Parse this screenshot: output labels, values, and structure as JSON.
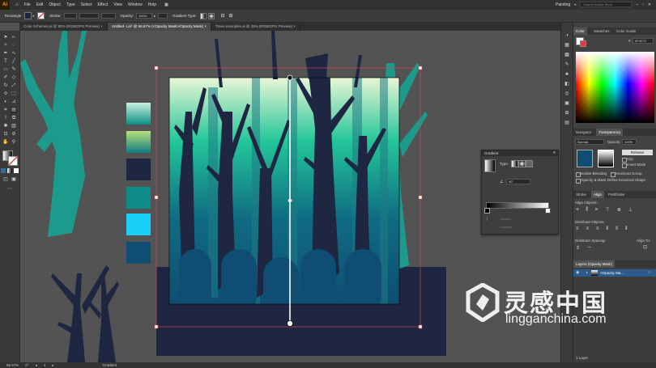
{
  "app": {
    "logo": "Ai",
    "home_icon": "home-icon"
  },
  "menu": [
    "File",
    "Edit",
    "Object",
    "Type",
    "Select",
    "Effect",
    "View",
    "Window",
    "Help"
  ],
  "workspace": "Painting",
  "search": {
    "placeholder": "Search Adobe Stock"
  },
  "controlbar": {
    "selection": "Rectangle",
    "stroke_label": "Stroke:",
    "opacity_label": "Opacity:",
    "opacity_value": "100%",
    "gradient_type_label": "Gradient Type:"
  },
  "tabs": [
    {
      "label": "Color Schemes.ai @ 80% (RGB/GPU Preview)",
      "active": false
    },
    {
      "label": "Untitled- Lai* @ 66.67% (<Opacity Mask>/Opacity Mask)",
      "active": true
    },
    {
      "label": "Trees examples.ai @ 25% (RGB/GPU Preview)",
      "active": false
    }
  ],
  "swatches": [
    "#69c9b6",
    "#6f9e4f",
    "#1e2641",
    "#0e8d88",
    "#19cff5",
    "#0f4d72"
  ],
  "color_panel": {
    "tabs": [
      "Color",
      "Swatches",
      "Color Guide"
    ],
    "hex": "0F4D72"
  },
  "navigator_panel": {
    "tabs": [
      "Navigator",
      "Transparency"
    ]
  },
  "transparency": {
    "blend_mode": "Normal",
    "opacity_label": "Opacity:",
    "opacity_value": "100%",
    "release_label": "Release",
    "clip_label": "Clip",
    "invert_label": "Invert Mask",
    "isolate_label": "Isolate Blending",
    "knockout_label": "Knockout Group",
    "opacity_shape_label": "Opacity & Mask Define Knockout Shape"
  },
  "align_panel": {
    "tabs": [
      "Stroke",
      "Align",
      "Pathfinder"
    ],
    "align_objects_label": "Align Objects:",
    "distribute_objects_label": "Distribute Objects:",
    "distribute_spacing_label": "Distribute Spacing:",
    "align_to_label": "Align To:"
  },
  "layers_panel": {
    "tab": "Layers (Opacity Mask)",
    "layer_name": "<Opacity Ma...",
    "footer": "1 Layer"
  },
  "gradient_panel": {
    "title": "Gradient",
    "type_label": "Type:",
    "angle_value": "90°",
    "opacity_label": "Opacity:",
    "location_label": "Location:"
  },
  "status": {
    "zoom": "66.67%",
    "page": "1",
    "tool": "Gradient"
  },
  "watermark": {
    "name": "灵感中国",
    "url": "lingganchina.com"
  },
  "colors": {
    "canvas_bg": "#535353",
    "teal": "#1c9a8c",
    "navy": "#1e2641",
    "selection": "#c94a4a"
  }
}
